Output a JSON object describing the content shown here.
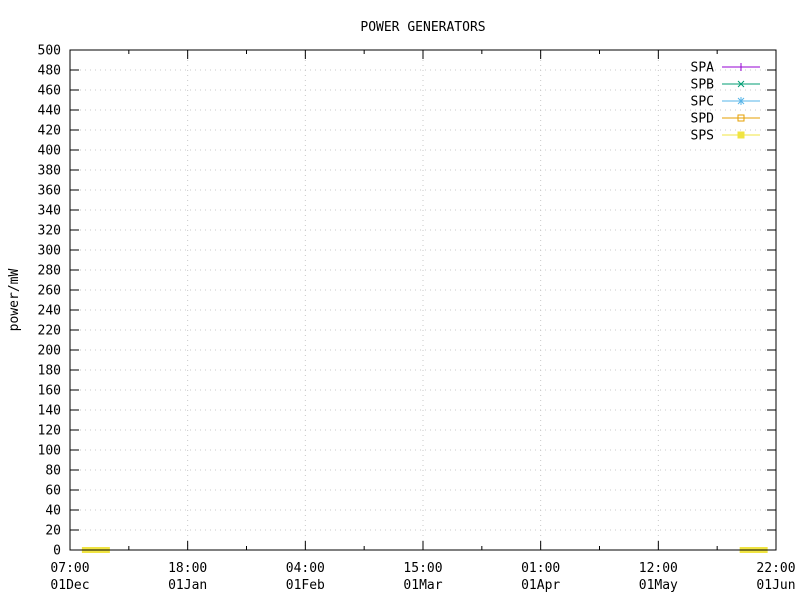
{
  "chart_data": {
    "type": "line",
    "title": "POWER GENERATORS",
    "xlabel": "",
    "ylabel": "power/mW",
    "ylim": [
      0,
      500
    ],
    "y_ticks": [
      0,
      20,
      40,
      60,
      80,
      100,
      120,
      140,
      160,
      180,
      200,
      220,
      240,
      260,
      280,
      300,
      320,
      340,
      360,
      380,
      400,
      420,
      440,
      460,
      480,
      500
    ],
    "x_ticks": [
      {
        "time": "07:00",
        "date": "01Dec"
      },
      {
        "time": "18:00",
        "date": "01Jan"
      },
      {
        "time": "04:00",
        "date": "01Feb"
      },
      {
        "time": "15:00",
        "date": "01Mar"
      },
      {
        "time": "01:00",
        "date": "01Apr"
      },
      {
        "time": "12:00",
        "date": "01May"
      },
      {
        "time": "22:00",
        "date": "01Jun"
      }
    ],
    "grid": true,
    "legend_position": "top-right",
    "series": [
      {
        "name": "SPA",
        "color": "#9400d3",
        "marker": "plus",
        "values": []
      },
      {
        "name": "SPB",
        "color": "#009e73",
        "marker": "cross",
        "values": []
      },
      {
        "name": "SPC",
        "color": "#56b4e9",
        "marker": "star",
        "values": []
      },
      {
        "name": "SPD",
        "color": "#e69f00",
        "marker": "open-square",
        "values": []
      },
      {
        "name": "SPS",
        "color": "#f0e442",
        "marker": "filled-square",
        "values": [
          {
            "x_index": 0.22,
            "y": 0
          },
          {
            "x_index": 5.81,
            "y": 0
          }
        ]
      }
    ]
  }
}
